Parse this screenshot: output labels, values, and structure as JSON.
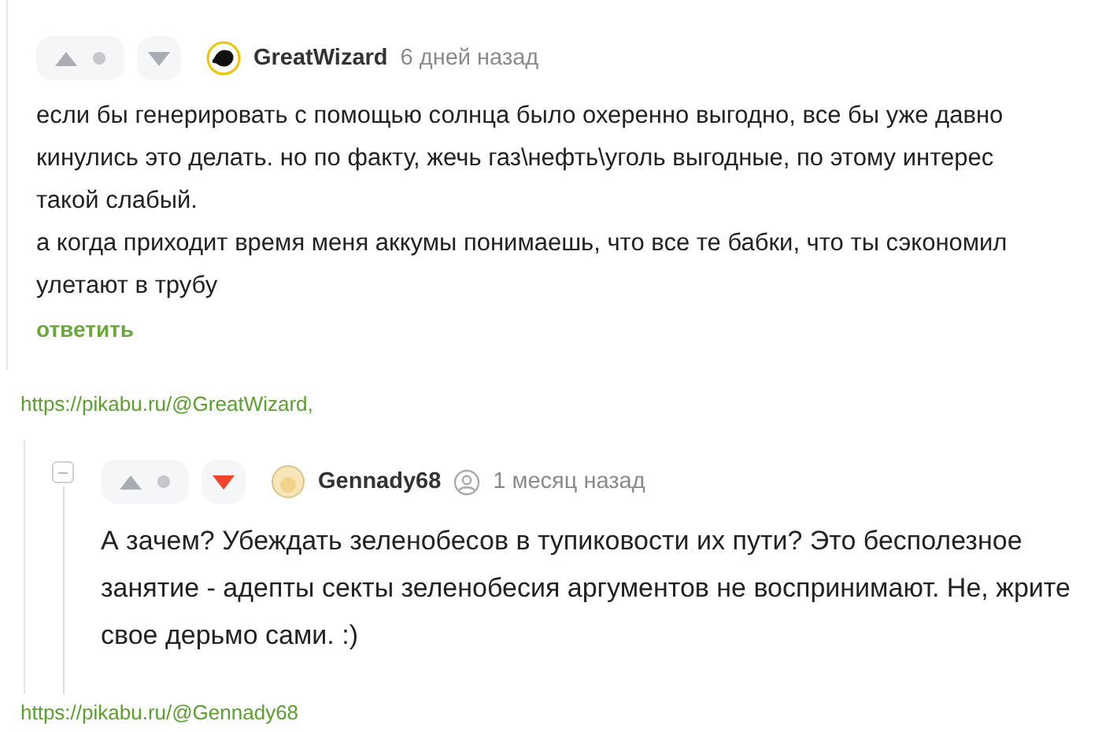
{
  "snippets": [
    {
      "comment": {
        "author": "GreatWizard",
        "time": "6 дней назад",
        "downvoted": false,
        "nested": false,
        "avatar": {
          "kind": "blot"
        },
        "profile_badge": false,
        "text": [
          "если бы генерировать с помощью солнца было охеренно выгодно, все бы уже давно кинулись это делать. но по факту, жечь газ\\нефть\\уголь выгодные, по этому интерес такой слабый.",
          "а когда приходит время меня аккумы понимаешь, что все те бабки, что ты сэкономил улетают в трубу"
        ],
        "reply": "ответить"
      },
      "link": "https://pikabu.ru/@GreatWizard,"
    },
    {
      "comment": {
        "author": "Gennady68",
        "time": "1 месяц назад",
        "downvoted": true,
        "nested": true,
        "avatar": {
          "kind": "face"
        },
        "profile_badge": true,
        "text": [
          "А зачем? Убеждать зеленобесов в тупиковости их пути? Это бесполезное занятие - адепты секты зеленобесия аргументов не воспринимают. Не, жрите свое дерьмо сами. :)"
        ]
      },
      "link": "https://pikabu.ru/@Gennady68"
    }
  ]
}
